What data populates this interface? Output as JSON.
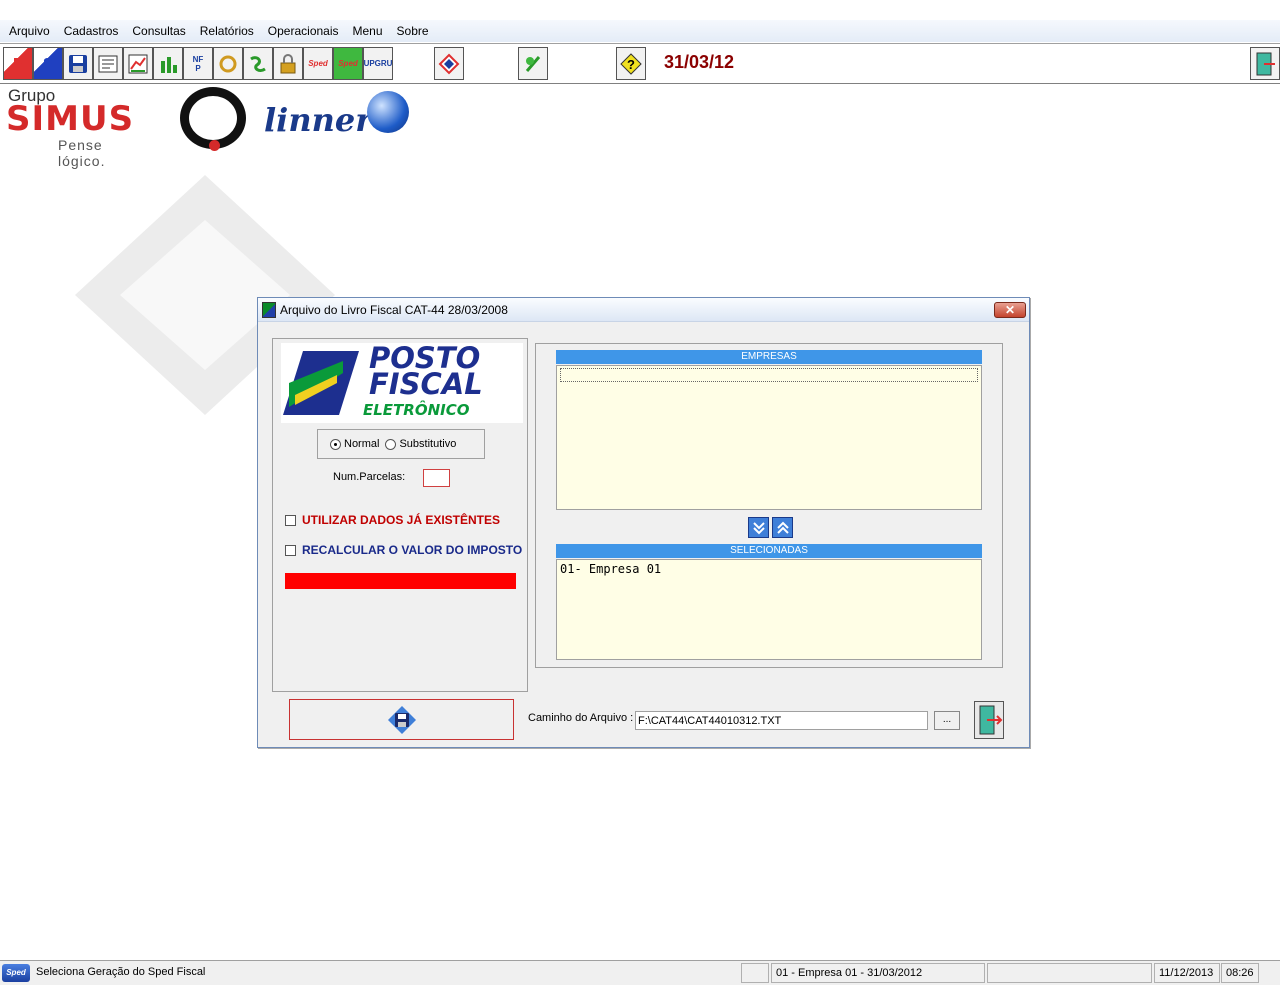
{
  "menu": {
    "items": [
      "Arquivo",
      "Cadastros",
      "Consultas",
      "Relatórios",
      "Operacionais",
      "Menu",
      "Sobre"
    ]
  },
  "toolbar": {
    "buttons": [
      {
        "icon": "e-icon"
      },
      {
        "icon": "s-icon"
      },
      {
        "icon": "save-icon"
      },
      {
        "icon": "report-icon"
      },
      {
        "icon": "chart-icon"
      },
      {
        "icon": "graph-icon"
      },
      {
        "icon": "nota-fiscal-paulista-icon"
      },
      {
        "icon": "refresh-icon"
      },
      {
        "icon": "arrow-icon"
      },
      {
        "icon": "lock-icon"
      },
      {
        "icon": "sped-icon"
      },
      {
        "icon": "sped-green-icon"
      },
      {
        "icon": "upgru-icon"
      },
      {
        "icon": "diamond-icon"
      },
      {
        "icon": "plant-icon"
      },
      {
        "icon": "help-icon"
      }
    ],
    "date": "31/03/12"
  },
  "logos": {
    "grupo": "Grupo",
    "simus": "SIMUS",
    "pense": "Pense lógico.",
    "linner": "linner"
  },
  "dialog": {
    "title": "Arquivo do Livro Fiscal CAT-44 28/03/2008",
    "close_label": "✕",
    "posto_fiscal": {
      "line1": "POSTO",
      "line2": "FISCAL",
      "line3": "ELETRÔNICO"
    },
    "radio_normal": "Normal",
    "radio_substitutivo": "Substitutivo",
    "num_parcelas_label": "Num.Parcelas:",
    "num_parcelas_value": "",
    "chk_utilizar": "UTILIZAR DADOS JÁ EXISTÊNTES",
    "chk_recalcular": "RECALCULAR O VALOR DO IMPOSTO",
    "empresas_header": "EMPRESAS",
    "empresas_items": [
      ""
    ],
    "selecionadas_header": "SELECIONADAS",
    "selecionadas_items": [
      "01- Empresa 01"
    ],
    "path_label": "Caminho do Arquivo :",
    "path_value": "F:\\CAT44\\CAT44010312.TXT",
    "browse_label": "..."
  },
  "statusbar": {
    "icon_text": "Sped",
    "message": "Seleciona Geração do Sped Fiscal",
    "empresa": "01 -  Empresa 01    - 31/03/2012",
    "date": "11/12/2013",
    "time": "08:26"
  },
  "colors": {
    "accent_blue": "#3f96e8",
    "date_red": "#8b0000",
    "check_label_red": "#c00000",
    "check_label_blue": "#1a2a8a",
    "list_bg": "#fffee6"
  }
}
